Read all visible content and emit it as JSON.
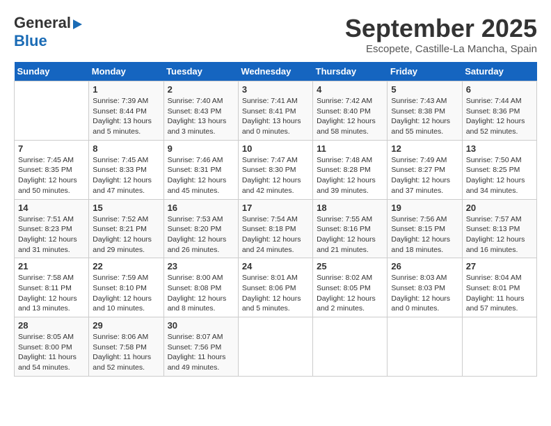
{
  "header": {
    "logo_line1": "General",
    "logo_line2": "Blue",
    "month": "September 2025",
    "location": "Escopete, Castille-La Mancha, Spain"
  },
  "days_of_week": [
    "Sunday",
    "Monday",
    "Tuesday",
    "Wednesday",
    "Thursday",
    "Friday",
    "Saturday"
  ],
  "weeks": [
    [
      {
        "day": "",
        "info": ""
      },
      {
        "day": "1",
        "info": "Sunrise: 7:39 AM\nSunset: 8:44 PM\nDaylight: 13 hours\nand 5 minutes."
      },
      {
        "day": "2",
        "info": "Sunrise: 7:40 AM\nSunset: 8:43 PM\nDaylight: 13 hours\nand 3 minutes."
      },
      {
        "day": "3",
        "info": "Sunrise: 7:41 AM\nSunset: 8:41 PM\nDaylight: 13 hours\nand 0 minutes."
      },
      {
        "day": "4",
        "info": "Sunrise: 7:42 AM\nSunset: 8:40 PM\nDaylight: 12 hours\nand 58 minutes."
      },
      {
        "day": "5",
        "info": "Sunrise: 7:43 AM\nSunset: 8:38 PM\nDaylight: 12 hours\nand 55 minutes."
      },
      {
        "day": "6",
        "info": "Sunrise: 7:44 AM\nSunset: 8:36 PM\nDaylight: 12 hours\nand 52 minutes."
      }
    ],
    [
      {
        "day": "7",
        "info": "Sunrise: 7:45 AM\nSunset: 8:35 PM\nDaylight: 12 hours\nand 50 minutes."
      },
      {
        "day": "8",
        "info": "Sunrise: 7:45 AM\nSunset: 8:33 PM\nDaylight: 12 hours\nand 47 minutes."
      },
      {
        "day": "9",
        "info": "Sunrise: 7:46 AM\nSunset: 8:31 PM\nDaylight: 12 hours\nand 45 minutes."
      },
      {
        "day": "10",
        "info": "Sunrise: 7:47 AM\nSunset: 8:30 PM\nDaylight: 12 hours\nand 42 minutes."
      },
      {
        "day": "11",
        "info": "Sunrise: 7:48 AM\nSunset: 8:28 PM\nDaylight: 12 hours\nand 39 minutes."
      },
      {
        "day": "12",
        "info": "Sunrise: 7:49 AM\nSunset: 8:27 PM\nDaylight: 12 hours\nand 37 minutes."
      },
      {
        "day": "13",
        "info": "Sunrise: 7:50 AM\nSunset: 8:25 PM\nDaylight: 12 hours\nand 34 minutes."
      }
    ],
    [
      {
        "day": "14",
        "info": "Sunrise: 7:51 AM\nSunset: 8:23 PM\nDaylight: 12 hours\nand 31 minutes."
      },
      {
        "day": "15",
        "info": "Sunrise: 7:52 AM\nSunset: 8:21 PM\nDaylight: 12 hours\nand 29 minutes."
      },
      {
        "day": "16",
        "info": "Sunrise: 7:53 AM\nSunset: 8:20 PM\nDaylight: 12 hours\nand 26 minutes."
      },
      {
        "day": "17",
        "info": "Sunrise: 7:54 AM\nSunset: 8:18 PM\nDaylight: 12 hours\nand 24 minutes."
      },
      {
        "day": "18",
        "info": "Sunrise: 7:55 AM\nSunset: 8:16 PM\nDaylight: 12 hours\nand 21 minutes."
      },
      {
        "day": "19",
        "info": "Sunrise: 7:56 AM\nSunset: 8:15 PM\nDaylight: 12 hours\nand 18 minutes."
      },
      {
        "day": "20",
        "info": "Sunrise: 7:57 AM\nSunset: 8:13 PM\nDaylight: 12 hours\nand 16 minutes."
      }
    ],
    [
      {
        "day": "21",
        "info": "Sunrise: 7:58 AM\nSunset: 8:11 PM\nDaylight: 12 hours\nand 13 minutes."
      },
      {
        "day": "22",
        "info": "Sunrise: 7:59 AM\nSunset: 8:10 PM\nDaylight: 12 hours\nand 10 minutes."
      },
      {
        "day": "23",
        "info": "Sunrise: 8:00 AM\nSunset: 8:08 PM\nDaylight: 12 hours\nand 8 minutes."
      },
      {
        "day": "24",
        "info": "Sunrise: 8:01 AM\nSunset: 8:06 PM\nDaylight: 12 hours\nand 5 minutes."
      },
      {
        "day": "25",
        "info": "Sunrise: 8:02 AM\nSunset: 8:05 PM\nDaylight: 12 hours\nand 2 minutes."
      },
      {
        "day": "26",
        "info": "Sunrise: 8:03 AM\nSunset: 8:03 PM\nDaylight: 12 hours\nand 0 minutes."
      },
      {
        "day": "27",
        "info": "Sunrise: 8:04 AM\nSunset: 8:01 PM\nDaylight: 11 hours\nand 57 minutes."
      }
    ],
    [
      {
        "day": "28",
        "info": "Sunrise: 8:05 AM\nSunset: 8:00 PM\nDaylight: 11 hours\nand 54 minutes."
      },
      {
        "day": "29",
        "info": "Sunrise: 8:06 AM\nSunset: 7:58 PM\nDaylight: 11 hours\nand 52 minutes."
      },
      {
        "day": "30",
        "info": "Sunrise: 8:07 AM\nSunset: 7:56 PM\nDaylight: 11 hours\nand 49 minutes."
      },
      {
        "day": "",
        "info": ""
      },
      {
        "day": "",
        "info": ""
      },
      {
        "day": "",
        "info": ""
      },
      {
        "day": "",
        "info": ""
      }
    ]
  ]
}
